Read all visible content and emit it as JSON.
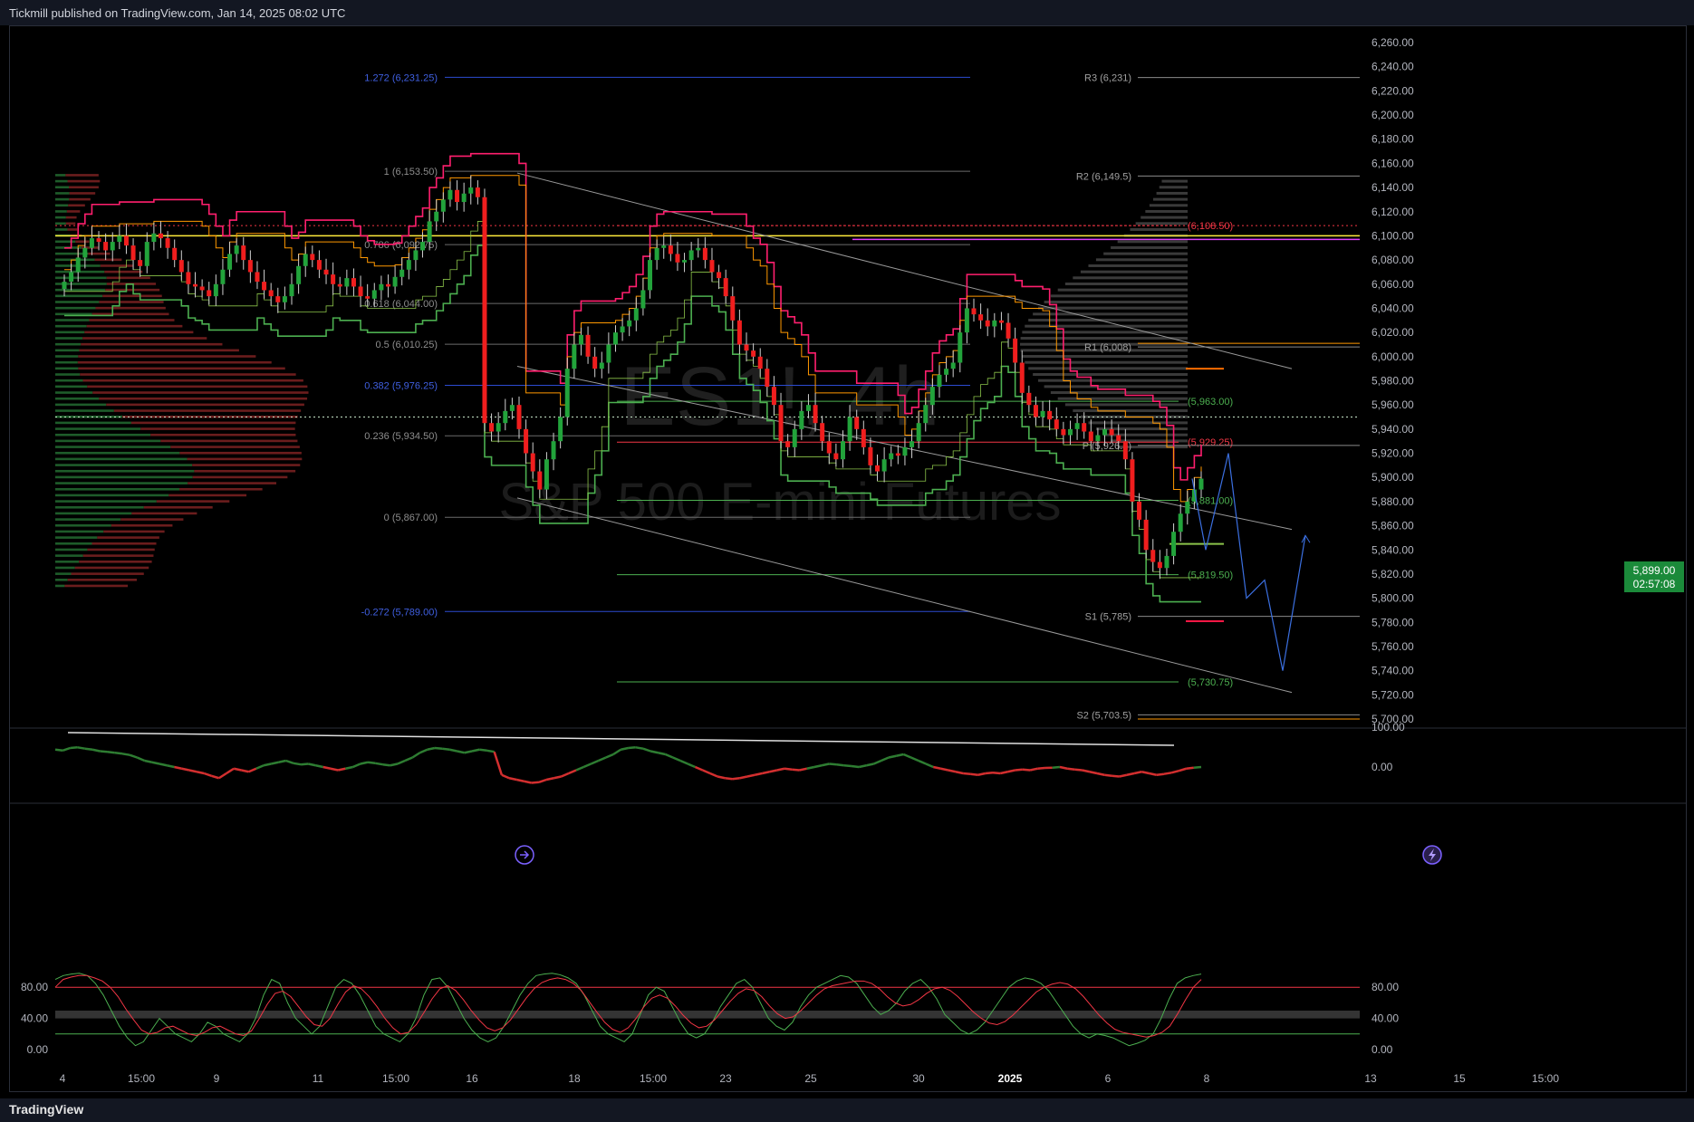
{
  "publish_text": "Tickmill published on TradingView.com, Jan 14, 2025 08:02 UTC",
  "brand": "TradingView",
  "watermark_symbol": "ES1!, 4h",
  "watermark_name": "S&P 500 E-mini Futures",
  "price_badge": {
    "price": "5,899.00",
    "countdown": "02:57:08",
    "color": "#1b8a3a"
  },
  "colors": {
    "up": "#22a33b",
    "down": "#f01e1e",
    "fib": "#6b6b6b",
    "fib_ext": "#2c4bd1",
    "pivot": "#8a8a8a",
    "channel": "#9a9a9a"
  },
  "chart_data": [
    {
      "type": "candlestick",
      "panel": "main",
      "ylim": [
        5700,
        6260
      ],
      "y_ticks": [
        "6,260.00",
        "6,240.00",
        "6,220.00",
        "6,200.00",
        "6,180.00",
        "6,160.00",
        "6,140.00",
        "6,120.00",
        "6,100.00",
        "6,080.00",
        "6,060.00",
        "6,040.00",
        "6,020.00",
        "6,000.00",
        "5,980.00",
        "5,960.00",
        "5,940.00",
        "5,920.00",
        "5,900.00",
        "5,880.00",
        "5,860.00",
        "5,840.00",
        "5,820.00",
        "5,800.00",
        "5,780.00",
        "5,760.00",
        "5,740.00",
        "5,720.00",
        "5,700.00"
      ],
      "x_ticks": [
        "4",
        "15:00",
        "9",
        "11",
        "15:00",
        "16",
        "18",
        "15:00",
        "23",
        "25",
        "30",
        "2025",
        "6",
        "8",
        "13",
        "15",
        "15:00"
      ],
      "close_series": [
        6062,
        6070,
        6082,
        6090,
        6098,
        6095,
        6088,
        6095,
        6100,
        6092,
        6080,
        6075,
        6095,
        6102,
        6098,
        6090,
        6080,
        6070,
        6060,
        6058,
        6055,
        6050,
        6060,
        6072,
        6085,
        6092,
        6080,
        6070,
        6062,
        6055,
        6050,
        6045,
        6050,
        6060,
        6075,
        6085,
        6080,
        6072,
        6068,
        6060,
        6058,
        6065,
        6058,
        6050,
        6048,
        6055,
        6060,
        6058,
        6066,
        6072,
        6080,
        6088,
        6095,
        6112,
        6120,
        6130,
        6138,
        6128,
        6135,
        6140,
        6132,
        5945,
        5938,
        5945,
        5955,
        5960,
        5940,
        5920,
        5905,
        5890,
        5915,
        5930,
        5950,
        5990,
        6010,
        6018,
        6000,
        5990,
        5995,
        6010,
        6020,
        6025,
        6030,
        6040,
        6055,
        6080,
        6090,
        6092,
        6085,
        6078,
        6080,
        6088,
        6090,
        6080,
        6070,
        6065,
        6050,
        6030,
        6010,
        6005,
        6000,
        5990,
        5975,
        5960,
        5930,
        5925,
        5940,
        5955,
        5960,
        5945,
        5930,
        5920,
        5915,
        5930,
        5950,
        5940,
        5925,
        5910,
        5905,
        5915,
        5920,
        5918,
        5925,
        5930,
        5945,
        5960,
        5975,
        5985,
        5990,
        5995,
        6020,
        6040,
        6035,
        6030,
        6025,
        6030,
        6028,
        6015,
        5995,
        5970,
        5960,
        5950,
        5955,
        5948,
        5940,
        5935,
        5940,
        5945,
        5938,
        5930,
        5935,
        5940,
        5935,
        5930,
        5915,
        5880,
        5865,
        5840,
        5830,
        5825,
        5835,
        5855,
        5870,
        5880,
        5890,
        5899
      ],
      "fib_levels": [
        {
          "label": "1.272 (6,231.25)",
          "value": 6231.25,
          "ext": true
        },
        {
          "label": "1 (6,153.50)",
          "value": 6153.5,
          "ext": false
        },
        {
          "label": "0.786 (6,092.75)",
          "value": 6092.75,
          "ext": false
        },
        {
          "label": "0.618 (6,044.00)",
          "value": 6044.0,
          "ext": false
        },
        {
          "label": "0.5 (6,010.25)",
          "value": 6010.25,
          "ext": false
        },
        {
          "label": "0.382 (5,976.25)",
          "value": 5976.25,
          "ext": true
        },
        {
          "label": "0.236 (5,934.50)",
          "value": 5934.5,
          "ext": false
        },
        {
          "label": "0 (5,867.00)",
          "value": 5867.0,
          "ext": false
        },
        {
          "label": "-0.272 (5,789.00)",
          "value": 5789.0,
          "ext": true
        }
      ],
      "pivots": [
        {
          "label": "R3 (6,231)",
          "value": 6231
        },
        {
          "label": "R2 (6,149.5)",
          "value": 6149.5
        },
        {
          "label": "R1 (6,008)",
          "value": 6008
        },
        {
          "label": "P (5,926.5)",
          "value": 5926.5
        },
        {
          "label": "S1 (5,785)",
          "value": 5785
        },
        {
          "label": "S2 (5,703.5)",
          "value": 5703.5
        }
      ],
      "level_labels": [
        {
          "label": "(6,108.50)",
          "value": 6108.5,
          "color": "#f23645"
        },
        {
          "label": "(5,963.00)",
          "value": 5963.0,
          "color": "#4caf50"
        },
        {
          "label": "(5,929.25)",
          "value": 5929.25,
          "color": "#f23645"
        },
        {
          "label": "(5,881.00)",
          "value": 5881.0,
          "color": "#4caf50"
        },
        {
          "label": "(5,819.50)",
          "value": 5819.5,
          "color": "#4caf50"
        },
        {
          "label": "(5,730.75)",
          "value": 5730.75,
          "color": "#4caf50"
        }
      ]
    },
    {
      "type": "line",
      "panel": "oscillator",
      "y_ticks": [
        "100.00",
        "0.00"
      ],
      "values": [
        55,
        52,
        60,
        62,
        58,
        55,
        50,
        48,
        45,
        42,
        38,
        30,
        20,
        15,
        10,
        5,
        0,
        -5,
        -10,
        -15,
        -20,
        -28,
        -35,
        -20,
        -5,
        -10,
        -15,
        -5,
        5,
        10,
        15,
        20,
        12,
        8,
        10,
        5,
        0,
        -5,
        -10,
        -5,
        0,
        10,
        15,
        12,
        8,
        5,
        10,
        20,
        30,
        45,
        55,
        60,
        58,
        55,
        50,
        45,
        50,
        55,
        52,
        48,
        -25,
        -35,
        -40,
        -45,
        -50,
        -48,
        -40,
        -35,
        -30,
        -20,
        -10,
        0,
        10,
        20,
        30,
        40,
        55,
        60,
        62,
        58,
        50,
        45,
        40,
        30,
        20,
        10,
        0,
        -10,
        -20,
        -30,
        -35,
        -38,
        -35,
        -30,
        -25,
        -20,
        -15,
        -10,
        -5,
        -8,
        -10,
        -5,
        0,
        5,
        10,
        8,
        5,
        3,
        0,
        5,
        10,
        20,
        30,
        35,
        40,
        30,
        20,
        10,
        0,
        -5,
        -10,
        -15,
        -20,
        -22,
        -25,
        -20,
        -18,
        -20,
        -15,
        -10,
        -8,
        -10,
        -5,
        -3,
        -2,
        0,
        -5,
        -8,
        -10,
        -15,
        -20,
        -25,
        -28,
        -30,
        -25,
        -20,
        -15,
        -20,
        -25,
        -22,
        -18,
        -12,
        -5,
        -2,
        0
      ],
      "trendline": true
    },
    {
      "type": "line",
      "panel": "stochastic",
      "y_ticks": [
        "80.00",
        "40.00",
        "0.00"
      ],
      "band": [
        40,
        50
      ],
      "series": [
        {
          "color": "#4caf50",
          "values": [
            90,
            95,
            97,
            98,
            95,
            85,
            70,
            50,
            30,
            15,
            5,
            10,
            25,
            40,
            30,
            20,
            15,
            10,
            20,
            35,
            30,
            20,
            15,
            10,
            20,
            40,
            70,
            90,
            85,
            60,
            40,
            30,
            20,
            30,
            55,
            80,
            90,
            85,
            70,
            50,
            30,
            20,
            15,
            10,
            20,
            40,
            70,
            90,
            92,
            80,
            60,
            40,
            25,
            15,
            10,
            15,
            30,
            50,
            70,
            85,
            95,
            97,
            98,
            96,
            92,
            85,
            70,
            50,
            30,
            20,
            15,
            10,
            20,
            45,
            70,
            80,
            75,
            55,
            35,
            20,
            15,
            20,
            35,
            55,
            70,
            85,
            90,
            80,
            60,
            40,
            30,
            25,
            35,
            55,
            70,
            80,
            85,
            90,
            95,
            93,
            85,
            70,
            55,
            45,
            50,
            60,
            75,
            85,
            90,
            80,
            65,
            45,
            35,
            25,
            20,
            25,
            35,
            50,
            65,
            80,
            88,
            92,
            90,
            85,
            75,
            60,
            45,
            30,
            20,
            15,
            20,
            18,
            15,
            10,
            5,
            8,
            12,
            20,
            40,
            65,
            85,
            92,
            95,
            97
          ]
        },
        {
          "color": "#f23645",
          "values": [
            80,
            90,
            93,
            95,
            95,
            92,
            88,
            80,
            68,
            52,
            38,
            25,
            20,
            22,
            28,
            30,
            25,
            20,
            18,
            22,
            28,
            30,
            25,
            20,
            18,
            24,
            40,
            58,
            72,
            75,
            68,
            55,
            42,
            32,
            30,
            40,
            58,
            74,
            82,
            78,
            68,
            55,
            40,
            28,
            20,
            22,
            32,
            48,
            65,
            78,
            82,
            76,
            64,
            50,
            38,
            28,
            24,
            28,
            38,
            52,
            66,
            78,
            86,
            90,
            92,
            90,
            85,
            76,
            62,
            48,
            35,
            26,
            22,
            28,
            40,
            55,
            66,
            70,
            66,
            56,
            44,
            34,
            28,
            30,
            38,
            50,
            62,
            72,
            78,
            76,
            68,
            56,
            46,
            40,
            42,
            50,
            60,
            70,
            78,
            82,
            84,
            86,
            88,
            88,
            85,
            78,
            68,
            60,
            56,
            58,
            64,
            72,
            78,
            80,
            76,
            68,
            58,
            48,
            40,
            34,
            32,
            36,
            44,
            54,
            64,
            74,
            80,
            84,
            86,
            84,
            78,
            68,
            56,
            44,
            34,
            26,
            22,
            20,
            18,
            16,
            18,
            22,
            30,
            46,
            64,
            80,
            90
          ]
        }
      ]
    }
  ]
}
